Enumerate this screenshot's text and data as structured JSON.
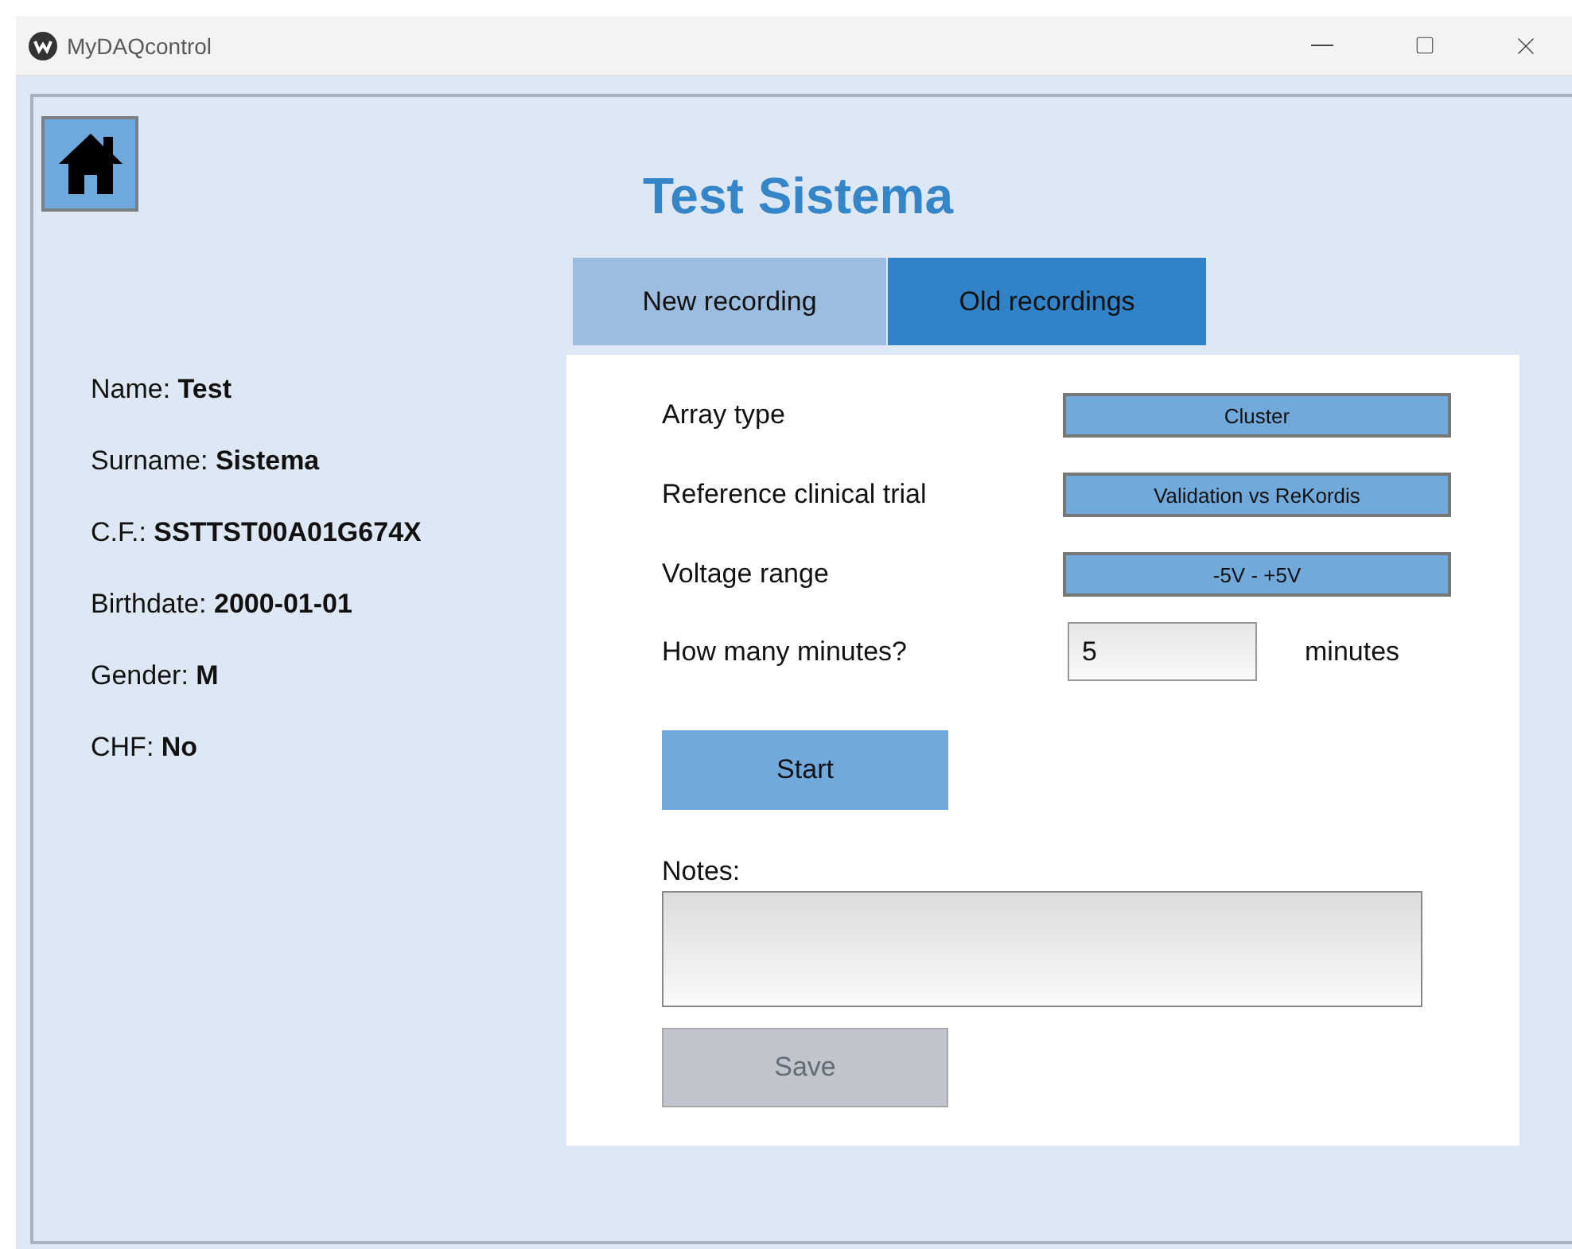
{
  "window": {
    "title": "MyDAQcontrol"
  },
  "header": {
    "title": "Test Sistema"
  },
  "patient": [
    "Name: **Test**",
    "Surname: **Sistema**",
    "C.F.: **SSTTST00A01G674X**",
    "Birthdate: **2000-01-01**",
    "Gender: **M**",
    "CHF: **No**"
  ],
  "tabs": [
    {
      "label": "New recording",
      "selected": false
    },
    {
      "label": "Old recordings",
      "selected": true
    }
  ],
  "form": {
    "rows": [
      {
        "kind": "dropdown",
        "label": "Array type",
        "value": "Cluster"
      },
      {
        "kind": "dropdown",
        "label": "Reference clinical trial",
        "value": "Validation vs ReKordis"
      },
      {
        "kind": "dropdown",
        "label": "Voltage range",
        "value": "-5V - +5V"
      },
      {
        "kind": "input",
        "label": "How many minutes?",
        "value": "5",
        "unit": "minutes"
      }
    ],
    "start_button": {
      "label": "Start",
      "disabled": false
    },
    "notes_label": "Notes:",
    "save_button": {
      "label": "Save",
      "disabled": true
    }
  }
}
